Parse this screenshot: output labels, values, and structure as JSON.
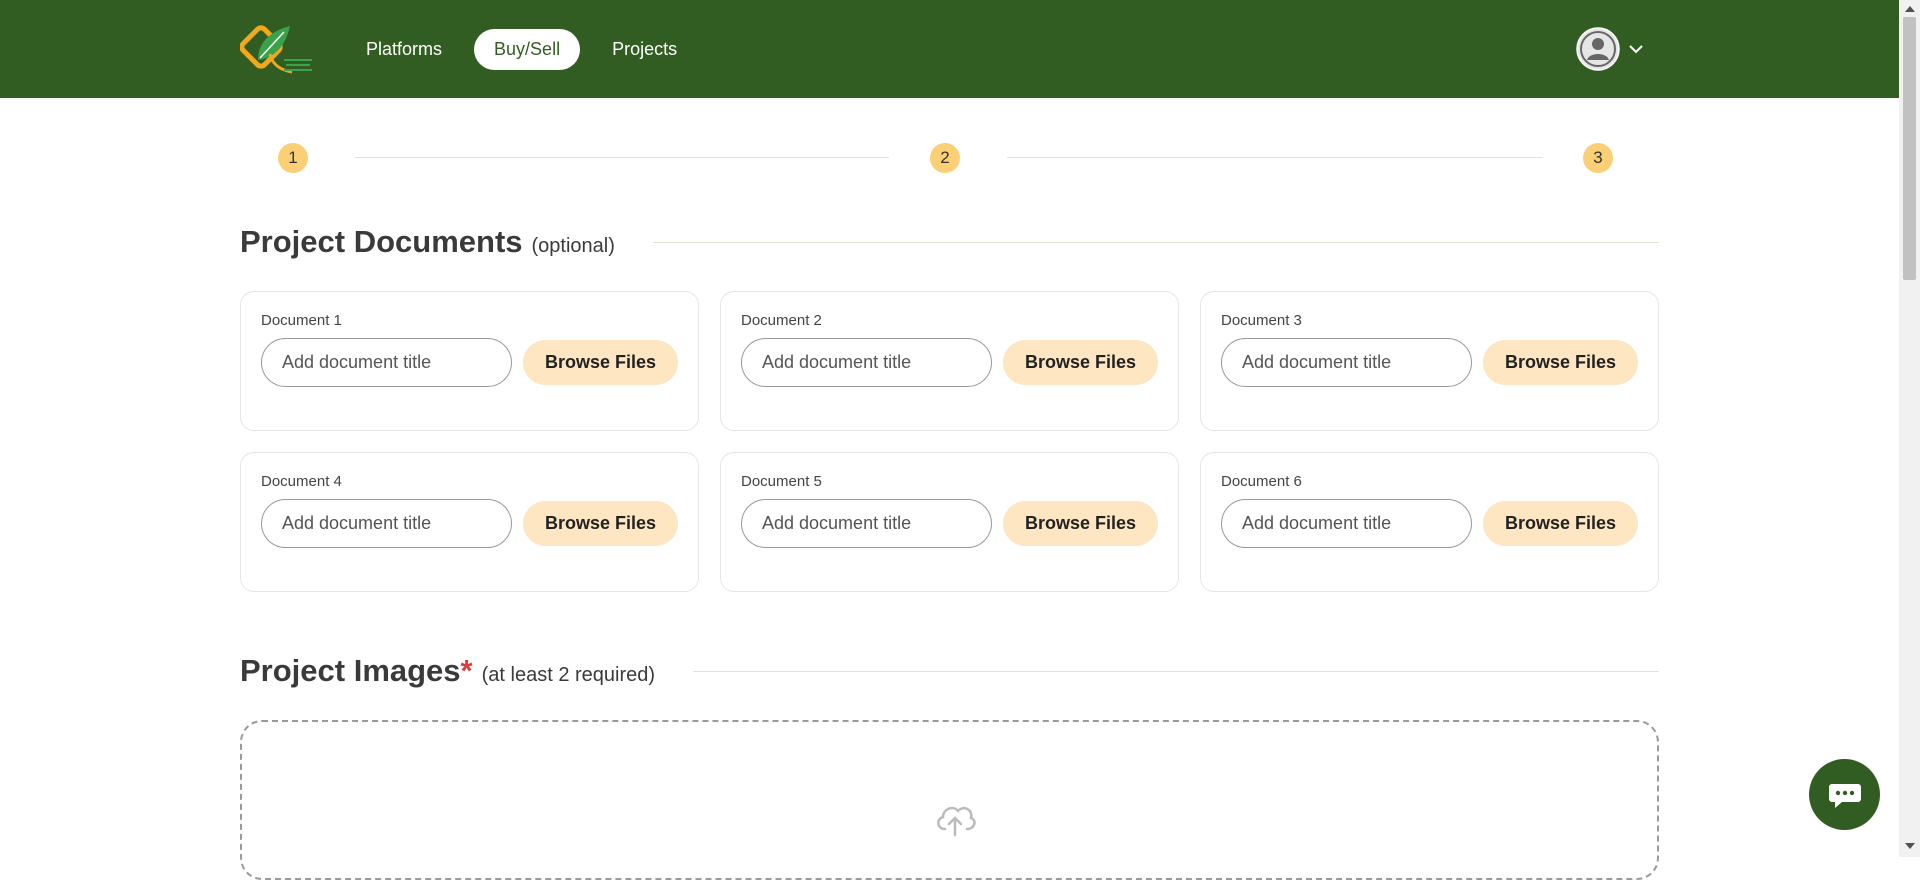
{
  "header": {
    "logo_icon": "leaf-logo-icon",
    "nav": [
      {
        "label": "Platforms",
        "active": false
      },
      {
        "label": "Buy/Sell",
        "active": true
      },
      {
        "label": "Projects",
        "active": false
      }
    ],
    "user_icon": "user-avatar-icon",
    "dropdown_icon": "chevron-down-icon"
  },
  "stepper": {
    "steps": [
      "1",
      "2",
      "3"
    ]
  },
  "documents_section": {
    "title": "Project Documents",
    "note": "(optional)",
    "cards": [
      {
        "label": "Document 1",
        "placeholder": "Add document title",
        "button": "Browse Files"
      },
      {
        "label": "Document 2",
        "placeholder": "Add document title",
        "button": "Browse Files"
      },
      {
        "label": "Document 3",
        "placeholder": "Add document title",
        "button": "Browse Files"
      },
      {
        "label": "Document 4",
        "placeholder": "Add document title",
        "button": "Browse Files"
      },
      {
        "label": "Document 5",
        "placeholder": "Add document title",
        "button": "Browse Files"
      },
      {
        "label": "Document 6",
        "placeholder": "Add document title",
        "button": "Browse Files"
      }
    ]
  },
  "images_section": {
    "title": "Project Images",
    "required_marker": "*",
    "note": "(at least 2 required)",
    "upload_icon": "cloud-upload-icon"
  },
  "chat": {
    "icon": "chat-bubble-icon"
  },
  "colors": {
    "brand_green": "#325d22",
    "step_yellow": "#fbcf75",
    "button_peach": "#fde6c1",
    "required_red": "#e23b3b"
  }
}
